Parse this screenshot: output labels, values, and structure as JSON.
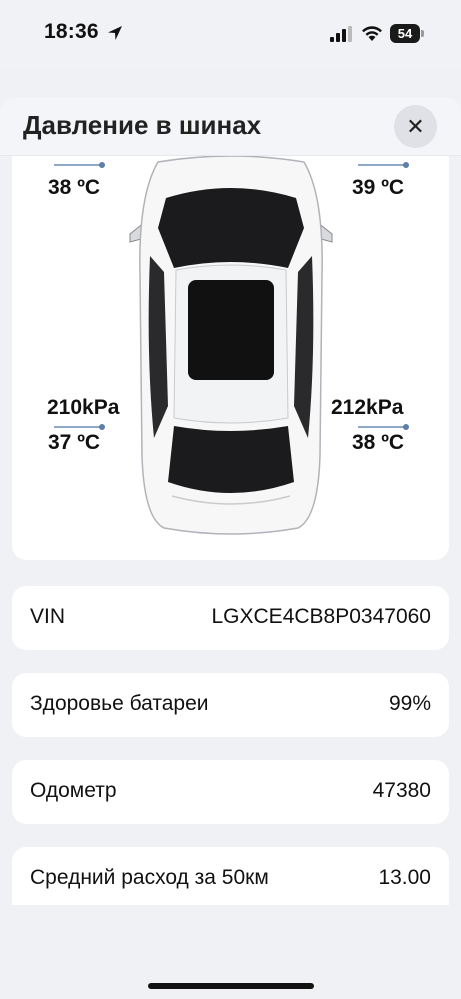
{
  "status_bar": {
    "time": "18:36",
    "battery": "54",
    "icons": [
      "location-arrow-icon",
      "signal-icon",
      "wifi-icon",
      "battery-icon"
    ]
  },
  "sheet": {
    "title": "Давление в шинах",
    "close_label": "✕"
  },
  "tires": {
    "front_left": {
      "temperature": "38 ºC"
    },
    "front_right": {
      "temperature": "39 ºC"
    },
    "rear_left": {
      "pressure": "210kPa",
      "temperature": "37 ºC"
    },
    "rear_right": {
      "pressure": "212kPa",
      "temperature": "38 ºC"
    }
  },
  "info": [
    {
      "label": "VIN",
      "value": "LGXCE4CB8P0347060"
    },
    {
      "label": "Здоровье батареи",
      "value": "99%"
    },
    {
      "label": "Одометр",
      "value": "47380"
    },
    {
      "label": "Средний расход за 50км",
      "value": "13.00"
    }
  ],
  "colors": {
    "background": "#eff1f5",
    "card": "#ffffff",
    "accent_line": "#8fa8c9"
  }
}
